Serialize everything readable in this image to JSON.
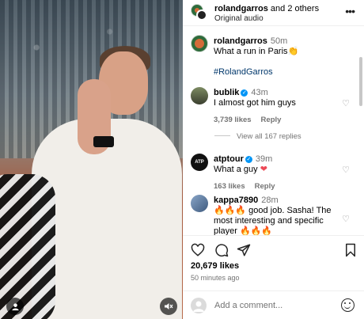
{
  "header": {
    "author": "rolandgarros",
    "coauthors": "and 2 others",
    "audio": "Original audio",
    "more_icon": "more-icon"
  },
  "caption": {
    "user": "rolandgarros",
    "time": "50m",
    "text": "What a run in Paris👏",
    "hashtag": "#RolandGarros"
  },
  "comments": [
    {
      "user": "bublik",
      "verified": true,
      "time": "43m",
      "text": "I almost got him guys",
      "likes": "3,739 likes",
      "reply": "Reply"
    },
    {
      "user": "atptour",
      "verified": true,
      "time": "39m",
      "text": "What a guy",
      "emoji": "❤",
      "likes": "163 likes",
      "reply": "Reply"
    },
    {
      "user": "kappa7890",
      "verified": false,
      "time": "28m",
      "text": "🔥🔥🔥 good job. Sasha! The most interesting and specific player 🔥🔥🔥"
    }
  ],
  "view_replies": "View all 167 replies",
  "actions": {
    "likes": "20,679 likes",
    "posted": "50 minutes ago"
  },
  "add_comment": {
    "placeholder": "Add a comment..."
  },
  "media": {
    "atp_logo_text": "ATP",
    "user_icon": "user-icon",
    "mute_icon": "muted-speaker-icon"
  },
  "colors": {
    "verified": "#0095f6",
    "heart_red": "#ed4956",
    "hashtag": "#00376b"
  }
}
